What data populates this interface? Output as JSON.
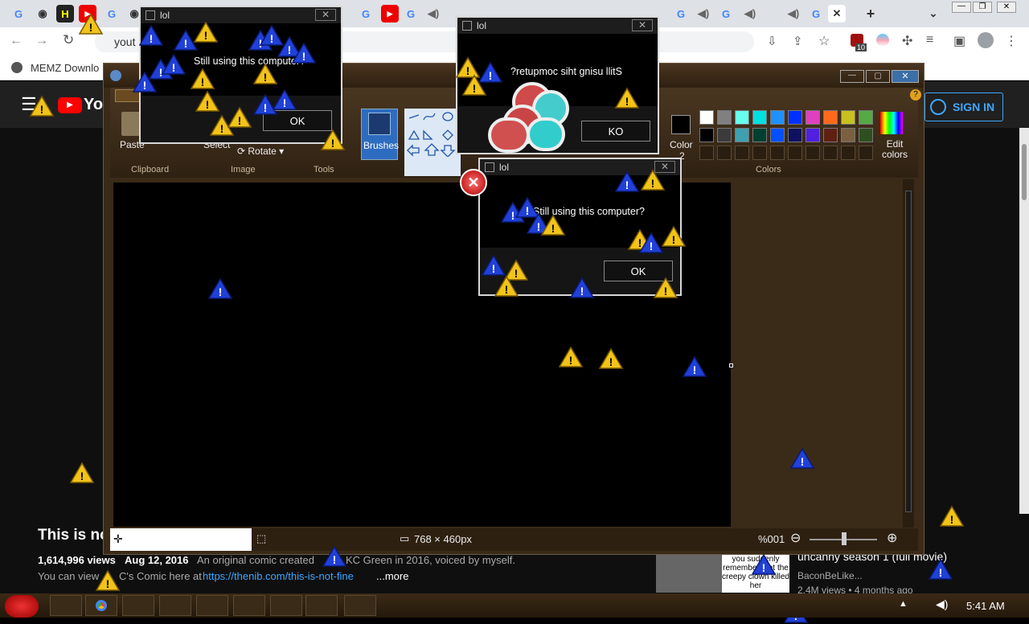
{
  "browser": {
    "address_text": "yout",
    "bookmark": "MEMZ Downlo",
    "extension_badge": "10"
  },
  "youtube": {
    "sign_in": "SIGN IN",
    "logo_text": "You",
    "video_title": "This is no",
    "views": "1,614,996 views",
    "date": "Aug 12, 2016",
    "desc1": "An original comic created",
    "desc1b": "KC Green in 2016, voiced by myself.",
    "desc2": "You can view",
    "desc2b": "C's Comic here at",
    "link": "https://thenib.com/this-is-not-fine",
    "more": "...more",
    "rec_title": "uncanny season 1 (full movie)",
    "rec_channel": "BaconBeLike...",
    "rec_meta": "2.4M views • 4 months ago",
    "rec_thumb_text": "you suddenly remember that the creepy clown killed her"
  },
  "paint": {
    "groups": {
      "clipboard": "Clipboard",
      "image": "Image",
      "tools": "Tools",
      "colors": "Colors"
    },
    "paste": "Paste",
    "select": "Select",
    "rotate": "Rotate",
    "brushes": "Brushes",
    "color2": "Color",
    "color2_num": "2",
    "edit_colors": "Edit colors",
    "status_size": "768 × 460px",
    "zoom": "%001",
    "palette": [
      "#ffffff",
      "#808080",
      "#66ffee",
      "#00e0e0",
      "#1e90ff",
      "#0030ff",
      "#e040c0",
      "#ff6a1a",
      "#c8c020",
      "#55aa44",
      "#000000",
      "#3b3b3b",
      "#3fa0b0",
      "#004030",
      "#0050ff",
      "#101060",
      "#5020e0",
      "#602010",
      "#7a6040",
      "#2e5020"
    ]
  },
  "dialogs": [
    {
      "title": "lol",
      "message": "Still using this computer?",
      "button": "OK"
    },
    {
      "title": "lol",
      "message": "?retupmoc siht gnisu llitS",
      "button": "KO"
    },
    {
      "title": "lol",
      "message": "Still using this computer?",
      "button": "OK"
    }
  ],
  "taskbar": {
    "time": "5:41 AM"
  }
}
